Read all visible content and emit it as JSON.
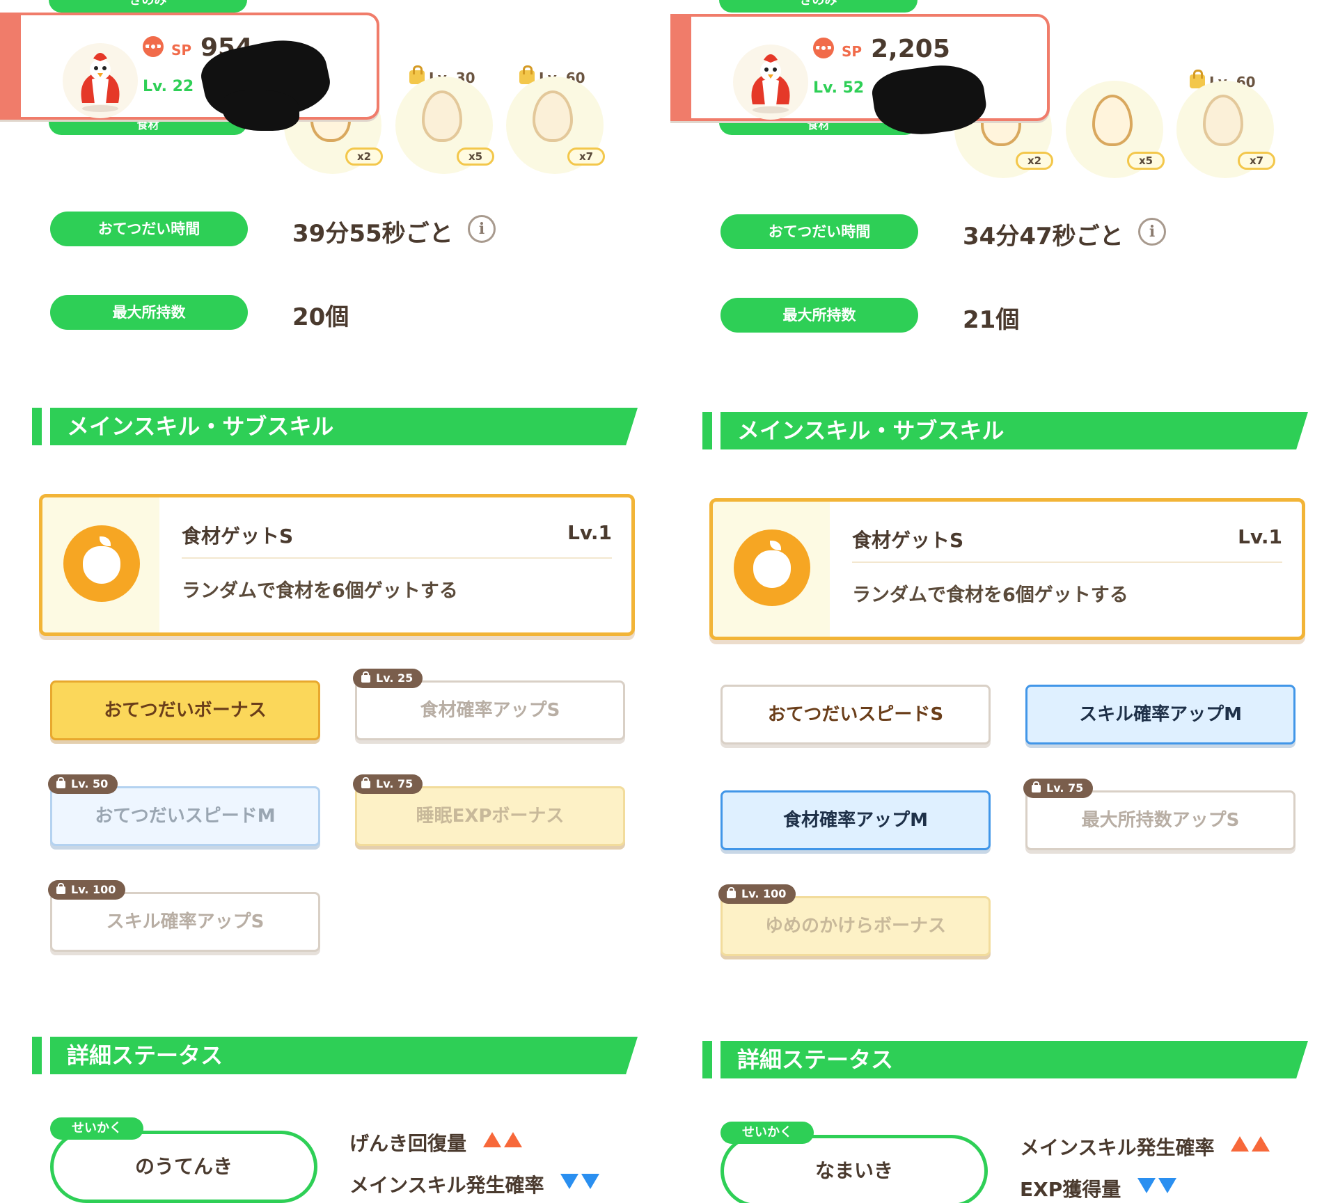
{
  "panels": [
    {
      "header": {
        "top_tab": "きのみ",
        "bottom_tab": "食材",
        "sp_label": "SP",
        "sp_value": "954",
        "level": "Lv. 22",
        "eggs": [
          {
            "mult": "x2",
            "lock": ""
          },
          {
            "mult": "x5",
            "lock": "Lv. 30"
          },
          {
            "mult": "x7",
            "lock": "Lv. 60"
          }
        ]
      },
      "help_time": {
        "label": "おてつだい時間",
        "value": "39分55秒ごと",
        "info_icon": "info-icon"
      },
      "max_carry": {
        "label": "最大所持数",
        "value": "20個"
      },
      "skills_heading": "メインスキル・サブスキル",
      "main_skill": {
        "name": "食材ゲットS",
        "level": "Lv.1",
        "desc": "ランダムで食材を6個ゲットする",
        "icon": "apple-icon"
      },
      "sub_skills": [
        {
          "label": "おてつだいボーナス",
          "lock": "",
          "style": "gold"
        },
        {
          "label": "食材確率アップS",
          "lock": "Lv. 25",
          "style": "white"
        },
        {
          "label": "おてつだいスピードM",
          "lock": "Lv. 50",
          "style": "blue"
        },
        {
          "label": "睡眠EXPボーナス",
          "lock": "Lv. 75",
          "style": "gold"
        },
        {
          "label": "スキル確率アップS",
          "lock": "Lv. 100",
          "style": "white"
        }
      ],
      "status_heading": "詳細ステータス",
      "nature": {
        "tag": "せいかく",
        "name": "のうてんき",
        "up": "げんき回復量",
        "down": "メインスキル発生確率"
      }
    },
    {
      "header": {
        "top_tab": "きのみ",
        "bottom_tab": "食材",
        "sp_label": "SP",
        "sp_value": "2,205",
        "level": "Lv. 52",
        "eggs": [
          {
            "mult": "x2",
            "lock": ""
          },
          {
            "mult": "x5",
            "lock": ""
          },
          {
            "mult": "x7",
            "lock": "Lv. 60"
          }
        ]
      },
      "help_time": {
        "label": "おてつだい時間",
        "value": "34分47秒ごと",
        "info_icon": "info-icon"
      },
      "max_carry": {
        "label": "最大所持数",
        "value": "21個"
      },
      "skills_heading": "メインスキル・サブスキル",
      "main_skill": {
        "name": "食材ゲットS",
        "level": "Lv.1",
        "desc": "ランダムで食材を6個ゲットする",
        "icon": "apple-icon"
      },
      "sub_skills": [
        {
          "label": "おてつだいスピードS",
          "lock": "",
          "style": "white"
        },
        {
          "label": "スキル確率アップM",
          "lock": "",
          "style": "blue"
        },
        {
          "label": "食材確率アップM",
          "lock": "",
          "style": "blue"
        },
        {
          "label": "最大所持数アップS",
          "lock": "Lv. 75",
          "style": "white"
        },
        {
          "label": "ゆめのかけらボーナス",
          "lock": "Lv. 100",
          "style": "gold"
        }
      ],
      "status_heading": "詳細ステータス",
      "nature": {
        "tag": "せいかく",
        "name": "なまいき",
        "up": "メインスキル発生確率",
        "down": "EXP獲得量"
      }
    }
  ],
  "colors": {
    "green": "#2ecf56",
    "coral": "#f07c6a",
    "gold": "#f2b437",
    "up": "#f7683a",
    "down": "#2a8ff0"
  }
}
